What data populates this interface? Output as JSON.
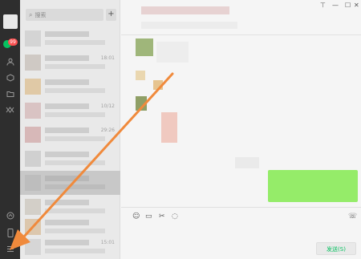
{
  "nav": {
    "badge_count": "99",
    "icons": [
      "chat-icon",
      "contacts-icon",
      "favorites-icon",
      "folder-icon",
      "moments-icon",
      "mini-program-icon",
      "phone-icon",
      "menu-icon"
    ]
  },
  "chat_list": {
    "search_placeholder": "搜索",
    "add_label": "+",
    "rows": [
      {
        "time": ""
      },
      {
        "time": "18:01"
      },
      {
        "time": ""
      },
      {
        "time": "10/12"
      },
      {
        "time": "29:26"
      },
      {
        "time": ""
      },
      {
        "time": ""
      },
      {
        "time": ""
      },
      {
        "time": ""
      },
      {
        "time": "15:01"
      }
    ]
  },
  "window": {
    "pin_label": "⊤",
    "minimize_label": "—",
    "maximize_label": "☐",
    "close_label": "✕"
  },
  "composer": {
    "send_label": "发送(S)"
  },
  "colors": {
    "sidebar": "#2e2e2e",
    "accent_green": "#07c160",
    "bubble_green": "#95ec69",
    "arrow_orange": "#f08a3c"
  }
}
